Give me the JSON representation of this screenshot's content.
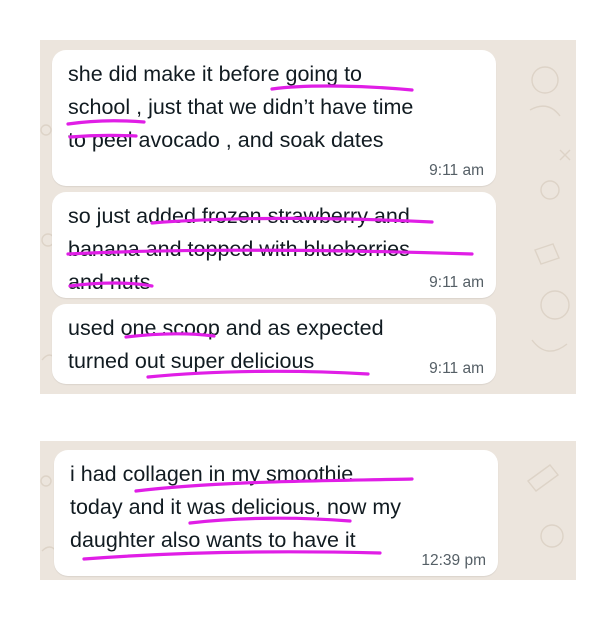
{
  "screenshot_1": {
    "messages": [
      {
        "text": "she did make it before going to\nschool , just that we didn’t have time\nto peel avocado , and soak dates",
        "time": "9:11 am"
      },
      {
        "text": "so just added frozen strawberry and\nbanana and topped with blueberries\nand nuts",
        "time": "9:11 am"
      },
      {
        "text": "used one scoop and as expected\nturned out super delicious",
        "time": "9:11 am"
      }
    ]
  },
  "screenshot_2": {
    "messages": [
      {
        "text": "i had collagen in my smoothie\ntoday and it was delicious, now my\ndaughter also wants to have it",
        "time": "12:39 pm"
      }
    ]
  },
  "colors": {
    "chat_background": "#ece5dd",
    "bubble": "#ffffff",
    "highlight_underline": "#e01ee6"
  }
}
